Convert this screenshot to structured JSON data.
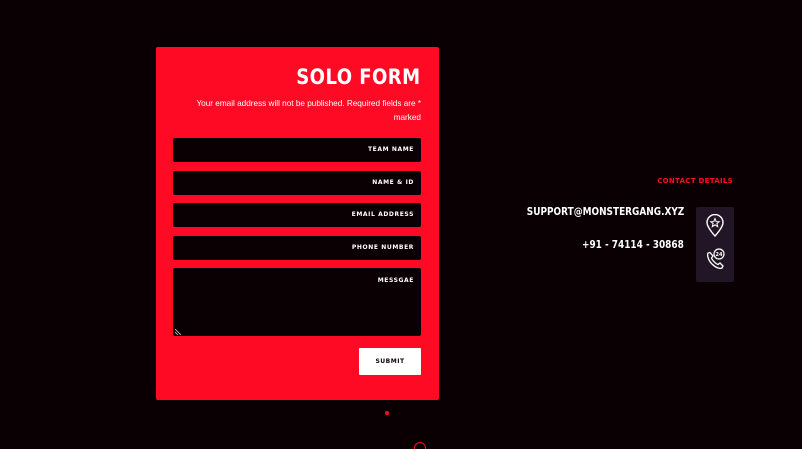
{
  "colors": {
    "background": "#0a0003",
    "accent": "#ff0a24",
    "panel": "#221526",
    "text": "#ffffff"
  },
  "form": {
    "title": "SOLO FORM",
    "note": "Your email address will not be published. Required fields are * marked",
    "fields": {
      "team_name": "TEAM  NAME",
      "name_id": "NAME & ID",
      "email": "EMAIL ADDRESS",
      "phone": "PHONE NUMBER",
      "message": "MESSGAE"
    },
    "submit_label": "SUBMIT"
  },
  "contact": {
    "heading": "CONTACT DETAILS",
    "email": "SUPPORT@MONSTERGANG.XYZ",
    "phone": "+91 - 74114 - 30868",
    "icons": [
      "location-pin-icon",
      "phone-24-icon"
    ]
  }
}
